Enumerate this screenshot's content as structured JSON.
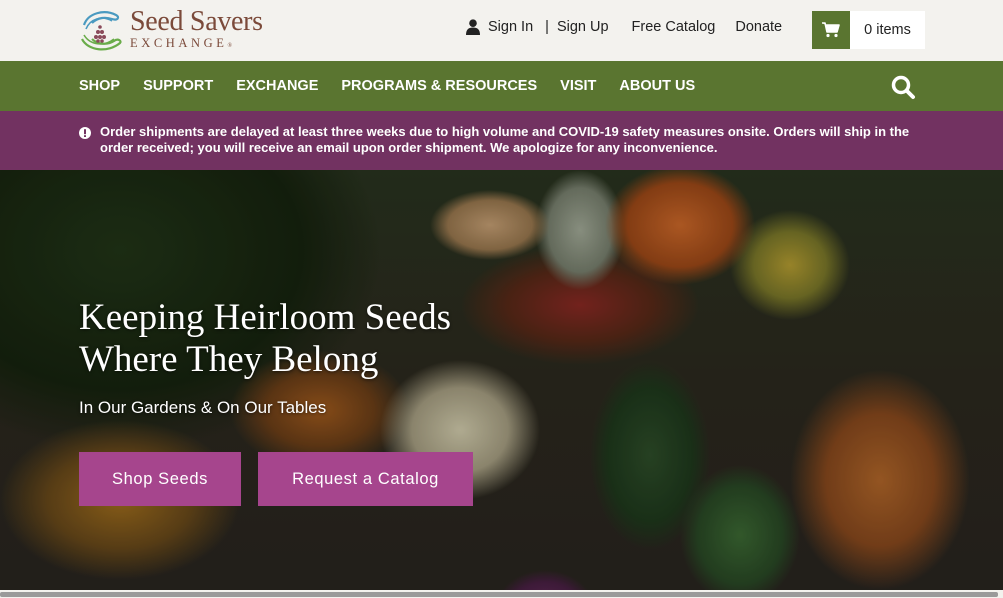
{
  "brand": {
    "name_line1": "Seed Savers",
    "name_line2": "EXCHANGE",
    "registered_mark": "®"
  },
  "header": {
    "sign_in": "Sign In",
    "separator": "|",
    "sign_up": "Sign Up",
    "free_catalog": "Free Catalog",
    "donate": "Donate",
    "cart_count": "0 items",
    "icons": {
      "user": "user-icon",
      "cart": "cart-icon"
    }
  },
  "nav": {
    "items": [
      "SHOP",
      "SUPPORT",
      "EXCHANGE",
      "PROGRAMS & RESOURCES",
      "VISIT",
      "ABOUT US"
    ],
    "search_icon": "search-icon"
  },
  "alert": {
    "icon": "exclamation-circle-icon",
    "text": "Order shipments are delayed at least three weeks due to high volume and COVID-19 safety measures onsite. Orders will ship in the order received; you will receive an email upon order shipment. We apologize for any inconvenience."
  },
  "hero": {
    "title_line1": "Keeping Heirloom Seeds",
    "title_line2": "Where They Belong",
    "subtitle": "In Our Gardens & On Our Tables",
    "primary_button": "Shop Seeds",
    "secondary_button": "Request a Catalog"
  },
  "colors": {
    "nav_green": "#5a7530",
    "alert_purple": "#723261",
    "button_magenta": "#a6458d",
    "brand_brown": "#7b4a3a",
    "header_bg": "#f3f2ee"
  }
}
